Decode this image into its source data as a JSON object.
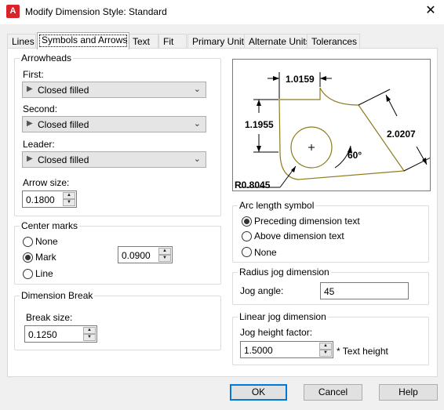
{
  "window": {
    "title": "Modify Dimension Style: Standard",
    "app_icon_letter": "A"
  },
  "tabs": [
    {
      "label": "Lines"
    },
    {
      "label": "Symbols and Arrows"
    },
    {
      "label": "Text"
    },
    {
      "label": "Fit"
    },
    {
      "label": "Primary Units"
    },
    {
      "label": "Alternate Units"
    },
    {
      "label": "Tolerances"
    }
  ],
  "arrowheads": {
    "legend": "Arrowheads",
    "first_label": "First:",
    "first_value": "Closed filled",
    "second_label": "Second:",
    "second_value": "Closed filled",
    "leader_label": "Leader:",
    "leader_value": "Closed filled",
    "arrow_size_label": "Arrow size:",
    "arrow_size_value": "0.1800"
  },
  "center_marks": {
    "legend": "Center marks",
    "options": [
      {
        "label": "None",
        "selected": false
      },
      {
        "label": "Mark",
        "selected": true
      },
      {
        "label": "Line",
        "selected": false
      }
    ],
    "size_value": "0.0900"
  },
  "dimension_break": {
    "legend": "Dimension Break",
    "break_size_label": "Break size:",
    "break_size_value": "0.1250"
  },
  "preview": {
    "dim_top": "1.0159",
    "dim_left": "1.1955",
    "dim_right": "2.0207",
    "angle": "60°",
    "radius": "R0.8045",
    "shape_color": "#8c7a1e"
  },
  "arc_length": {
    "legend": "Arc length symbol",
    "options": [
      {
        "label": "Preceding dimension text",
        "selected": true
      },
      {
        "label": "Above dimension text",
        "selected": false
      },
      {
        "label": "None",
        "selected": false
      }
    ]
  },
  "radius_jog": {
    "legend": "Radius jog dimension",
    "jog_angle_label": "Jog angle:",
    "jog_angle_value": "45"
  },
  "linear_jog": {
    "legend": "Linear jog dimension",
    "height_label": "Jog height factor:",
    "height_value": "1.5000",
    "height_suffix": "* Text height"
  },
  "footer": {
    "ok": "OK",
    "cancel": "Cancel",
    "help": "Help"
  },
  "colors": {
    "accent": "#0078d7",
    "icon_red": "#d8232a"
  }
}
